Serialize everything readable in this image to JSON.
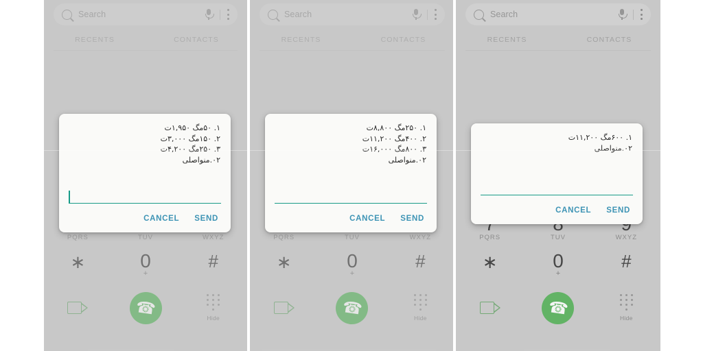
{
  "app": {
    "name": "Phone Dialer",
    "accent_green": "#4caf50",
    "accent_teal": "#169b87",
    "accent_blue": "#3e94b5",
    "background": "#c9c9c9"
  },
  "search": {
    "placeholder": "Search",
    "icon": "search-icon",
    "mic_icon": "microphone-icon",
    "menu_icon": "kebab-menu-icon"
  },
  "tabs": [
    {
      "label": "RECENTS"
    },
    {
      "label": "CONTACTS"
    }
  ],
  "keypad": {
    "keys": [
      {
        "num": "7",
        "sub": "PQRS"
      },
      {
        "num": "8",
        "sub": "TUV"
      },
      {
        "num": "9",
        "sub": "WXYZ"
      },
      {
        "num": "∗",
        "sub": ""
      },
      {
        "num": "0",
        "sub": "+"
      },
      {
        "num": "#",
        "sub": ""
      }
    ],
    "video_call_icon": "video-camera-icon",
    "call_icon": "phone-handset-icon",
    "hide_icon": "keypad-dots-icon",
    "hide_label": "Hide"
  },
  "dialogs": [
    {
      "id": "dialog-1",
      "message": "۱. ۵۰مگ ۱,۹۵۰ت\n۲. ۱۵۰مگ ۳,۰۰۰ت\n۳. ۲۵۰مگ ۴,۲۰۰ت\n۰۲.منواصلی",
      "input_value": "",
      "has_caret": true,
      "cancel_label": "CANCEL",
      "send_label": "SEND"
    },
    {
      "id": "dialog-2",
      "message": "۱. ۲۵۰مگ ۸,۸۰۰ت\n۲. ۴۰۰مگ ۱۱,۲۰۰ت\n۳. ۸۰۰مگ ۱۶,۰۰۰ت\n۰۲.منواصلی",
      "input_value": "",
      "has_caret": false,
      "cancel_label": "CANCEL",
      "send_label": "SEND"
    },
    {
      "id": "dialog-3",
      "message": "۱. ۶۰۰مگ ۱۱,۲۰۰ت\n۰۲.منواصلی",
      "input_value": "",
      "has_caret": false,
      "cancel_label": "CANCEL",
      "send_label": "SEND"
    }
  ]
}
